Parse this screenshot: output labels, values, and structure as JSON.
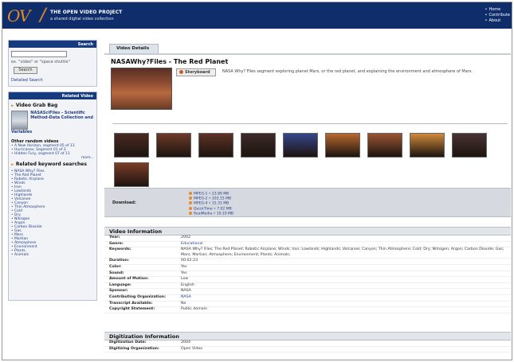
{
  "header": {
    "logo": "OV",
    "title": "THE OPEN VIDEO PROJECT",
    "subtitle": "a shared digital video collection",
    "nav": [
      "Home",
      "Contribute",
      "About"
    ]
  },
  "search": {
    "heading": "Search",
    "placeholder": "",
    "hint": "ex. \"video\" or \"space shuttle\"",
    "button": "Search",
    "advanced": "Detailed Search"
  },
  "related": {
    "heading": "Related Video",
    "grab_bag_heading": "Video Grab Bag",
    "grab_video_title": "NASASciFiles - Scientific Method-Data Collection and",
    "grab_video_cont": "Variables",
    "other_heading": "Other random videos",
    "others": [
      "A New Horizon, segment 05 of 13",
      "Hurricanes, Segment 01 of 3",
      "Hidden Fury, segment 07 of 11"
    ],
    "more": "more...",
    "keyword_heading": "Related keyword searches",
    "keywords": [
      "NASA Why? Files",
      "The Red Planet",
      "Robotic Airplane",
      "Winds",
      "Iron",
      "Lowlands",
      "Highlands",
      "Volcanoe",
      "Canyon",
      "Thin Atmosphere",
      "Cold",
      "Dry",
      "Nitrogen",
      "Argon",
      "Carbon Dioxide",
      "Gas",
      "Mars",
      "Martian",
      "Atmosphere",
      "Environment",
      "Plants",
      "Animals"
    ]
  },
  "main": {
    "tab": "Video Details",
    "title": "NASAWhy?Files - The Red Planet",
    "storyboard_button": "Storyboard",
    "description": "NASA Why? Files segment exploring planet Mars, or the red planet, and explaining the environment and atmosphere of Mars.",
    "download_label": "Download:",
    "downloads": [
      "MPEG-1 • 23.89 MB",
      "MPEG-2 • 103.15 MB",
      "MPEG-4 • 15.31 MB",
      "QuickTime • 7.02 MB",
      "RealMedia • 19.10 MB"
    ],
    "frame_colors": [
      "#4a2a22",
      "#6b3a2a",
      "#5c3326",
      "#3d2a28",
      "#35468a",
      "#b9682f",
      "#9a5532",
      "#d08a3a",
      "#493233",
      "#7a3d28"
    ]
  },
  "video_info": {
    "heading": "Video Information",
    "rows": [
      {
        "k": "Year:",
        "v": "2002"
      },
      {
        "k": "Genre:",
        "v": "Educational",
        "link": true
      },
      {
        "k": "Keywords:",
        "v": "NASA Why? Files; The Red Planet; Robotic Airplane; Winds; Iron; Lowlands; Highlands; Volcanoe; Canyon; Thin Atmosphere; Cold; Dry; Nitrogen; Argon; Carbon Dioxide; Gas; Mars; Martian; Atmosphere; Environment; Plants; Animals;"
      },
      {
        "k": "Duration:",
        "v": "00:02:23"
      },
      {
        "k": "Color:",
        "v": "Yes"
      },
      {
        "k": "Sound:",
        "v": "Yes"
      },
      {
        "k": "Amount of Motion:",
        "v": "Low"
      },
      {
        "k": "Language:",
        "v": "English"
      },
      {
        "k": "Sponsor:",
        "v": "NASA"
      },
      {
        "k": "Contributing Organization:",
        "v": "NASA",
        "link": true
      },
      {
        "k": "Transcript Available:",
        "v": "No"
      },
      {
        "k": "Copyright Statement:",
        "v": "Public domain"
      }
    ]
  },
  "digitization": {
    "heading": "Digitization Information",
    "rows": [
      {
        "k": "Digitization Date:",
        "v": "2004"
      },
      {
        "k": "Digitizing Organization:",
        "v": "Open Video"
      }
    ]
  }
}
